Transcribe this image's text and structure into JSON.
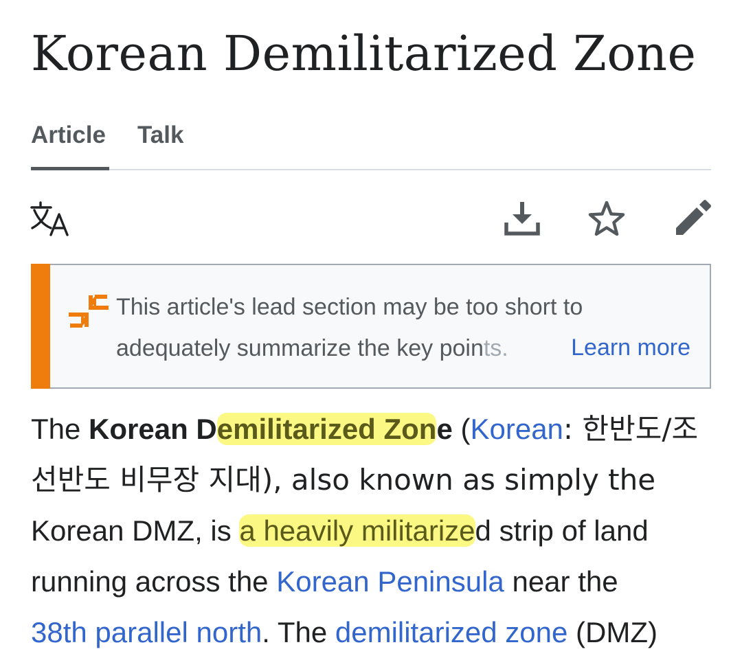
{
  "article": {
    "title": "Korean Demilitarized Zone"
  },
  "tabs": {
    "article": "Article",
    "talk": "Talk"
  },
  "toolbar": {
    "icons": [
      "translate-icon",
      "download-icon",
      "star-icon",
      "edit-icon"
    ]
  },
  "notice": {
    "text_main": "This article's lead section may be too short to adequately summarize the key poin",
    "text_fade": "ts.",
    "learn_more": "Learn more",
    "accent_color": "#ee7d0e",
    "icon": "lead-too-short-icon"
  },
  "body": {
    "p1": "The ",
    "bold_a": "Korean D",
    "bold_hl": "emilitarized Zon",
    "bold_b": "e",
    "p2": " (",
    "link_korean": "Korean",
    "p3": ": 한반도/조",
    "p4": "선반도 비무장 지대), also known as simply the",
    "p5": "Korean DMZ, is ",
    "hl2": "a heavily militarize",
    "p6": "d strip of land",
    "p7": "running across the ",
    "link_peninsula": "Korean Peninsula",
    "p8": " near the",
    "link_38th": "38th parallel north",
    "p9": ". The ",
    "link_dmz": "demilitarized zone",
    "p10": " (DMZ)"
  },
  "colors": {
    "link": "#3366cc",
    "highlight": "#faf55a",
    "text": "#202122"
  }
}
